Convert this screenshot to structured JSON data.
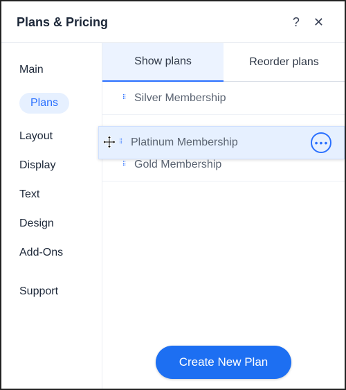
{
  "header": {
    "title": "Plans & Pricing",
    "help_glyph": "?",
    "close_glyph": "✕"
  },
  "sidebar": {
    "items": [
      {
        "id": "main",
        "label": "Main",
        "active": false
      },
      {
        "id": "plans",
        "label": "Plans",
        "active": true
      },
      {
        "id": "layout",
        "label": "Layout",
        "active": false
      },
      {
        "id": "display",
        "label": "Display",
        "active": false
      },
      {
        "id": "text",
        "label": "Text",
        "active": false
      },
      {
        "id": "design",
        "label": "Design",
        "active": false
      },
      {
        "id": "addons",
        "label": "Add-Ons",
        "active": false
      }
    ],
    "support_label": "Support"
  },
  "tabs": {
    "show_plans": "Show plans",
    "reorder_plans": "Reorder plans",
    "active_index": 0
  },
  "plans": [
    {
      "name": "Silver Membership",
      "dragging": false
    },
    {
      "name": "Platinum Membership",
      "dragging": true
    },
    {
      "name": "Gold Membership",
      "dragging": false
    }
  ],
  "glyphs": {
    "drag_dots": "⠿",
    "more_dots": "•••"
  },
  "footer": {
    "create_label": "Create New Plan"
  }
}
